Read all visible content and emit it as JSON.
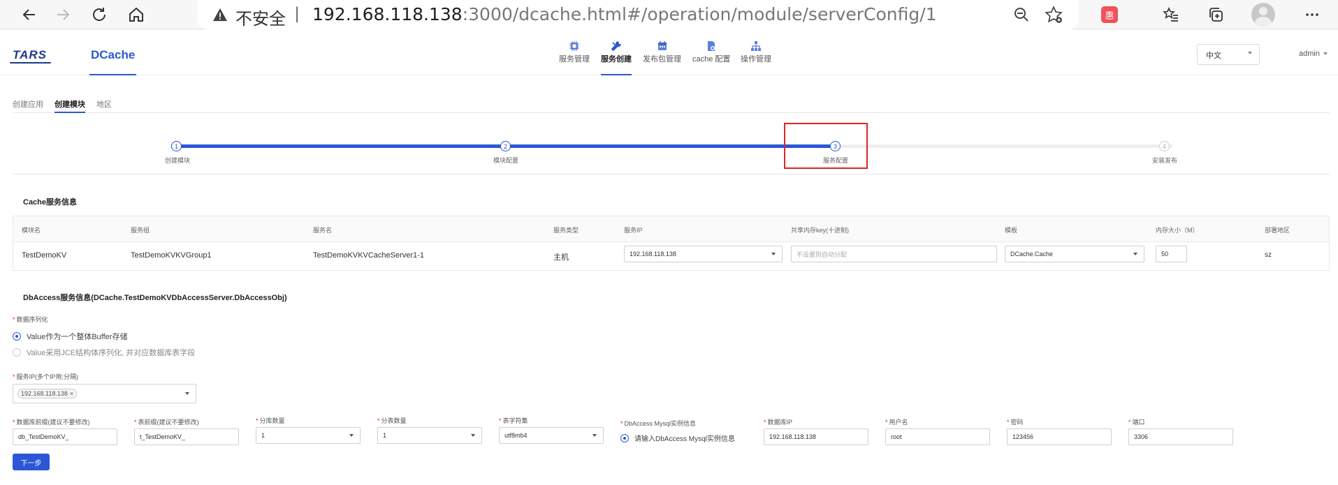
{
  "browser": {
    "insecure_label": "不安全",
    "separator": "|",
    "url_host": "192.168.118.138",
    "url_rest": ":3000/dcache.html#/operation/module/serverConfig/1",
    "ext_label": "惠"
  },
  "header": {
    "logo_tars": "TARS",
    "logo_dcache": "DCache",
    "nav": [
      {
        "label": "服务管理",
        "icon": "chip-icon"
      },
      {
        "label": "服务创建",
        "icon": "wrench-icon"
      },
      {
        "label": "发布包管理",
        "icon": "calendar-icon"
      },
      {
        "label": "cache 配置",
        "icon": "document-gear-icon"
      },
      {
        "label": "操作管理",
        "icon": "org-chart-icon"
      }
    ],
    "active_nav": "服务创建",
    "language": "中文",
    "user": "admin"
  },
  "tabs": [
    "创建应用",
    "创建模块",
    "地区"
  ],
  "active_tab": "创建模块",
  "steps": [
    {
      "num": "1",
      "label": "创建模块",
      "state": "done"
    },
    {
      "num": "2",
      "label": "模块配置",
      "state": "done"
    },
    {
      "num": "3",
      "label": "服务配置",
      "state": "current"
    },
    {
      "num": "4",
      "label": "安装发布",
      "state": "todo"
    }
  ],
  "cache_section": {
    "title": "Cache服务信息",
    "columns": [
      "模块名",
      "服务组",
      "服务名",
      "服务类型",
      "服务IP",
      "共享内存key(十进制)",
      "模板",
      "内存大小（M）",
      "部署地区"
    ],
    "row": {
      "module": "TestDemoKV",
      "group": "TestDemoKVKVGroup1",
      "server": "TestDemoKVKVCacheServer1-1",
      "type": "主机",
      "ip": "192.168.118.138",
      "shm_placeholder": "不设置则自动分配",
      "template": "DCache.Cache",
      "memory": "50",
      "region": "sz"
    }
  },
  "dbaccess_section": {
    "title": "DbAccess服务信息(DCache.TestDemoKVDbAccessServer.DbAccessObj)",
    "serialize_label": "数据序列化",
    "serialize_options": [
      "Value作为一个整体Buffer存储",
      "Value采用JCE结构体序列化, 并对应数据库表字段"
    ],
    "serialize_selected": 0,
    "ip_label": "服务IP(多个IP用;分隔)",
    "ip_tag": "192.168.118.138",
    "ip_tag_close": "×",
    "fields": {
      "db_prefix": {
        "label": "数据库前缀(建议不要修改)",
        "value": "db_TestDemoKV_"
      },
      "table_prefix": {
        "label": "表前缀(建议不要修改)",
        "value": "t_TestDemoKV_"
      },
      "db_count": {
        "label": "分库数量",
        "value": "1"
      },
      "table_count": {
        "label": "分表数量",
        "value": "1"
      },
      "charset": {
        "label": "表字符集",
        "value": "utf8mb4"
      },
      "mysql_info": {
        "label": "DbAccess Mysql实例信息",
        "option": "请输入DbAccess Mysql实例信息"
      },
      "db_ip": {
        "label": "数据库IP",
        "value": "192.168.118.138"
      },
      "username": {
        "label": "用户名",
        "value": "root"
      },
      "password": {
        "label": "密码",
        "value": "123456"
      },
      "port": {
        "label": "端口",
        "value": "3306"
      }
    },
    "required_mark": "*"
  },
  "next_button": "下一步",
  "colors": {
    "accent": "#2b57d6",
    "highlight": "#e02424",
    "line_todo": "#eeeeee"
  }
}
